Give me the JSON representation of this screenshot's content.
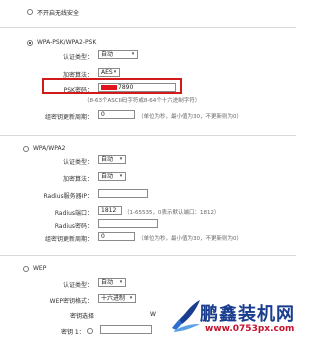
{
  "no_security": {
    "label": "不开启无线安全"
  },
  "wpa_psk": {
    "title": "WPA-PSK/WPA2-PSK",
    "auth_label": "认证类型：",
    "auth_value": "自动",
    "enc_label": "加密算法：",
    "enc_value": "AES",
    "psk_label": "PSK密码：",
    "psk_value": "7890",
    "psk_hint": "（8-63个ASCII码字符或8-64个十六进制字符）",
    "period_label": "组密钥更新周期：",
    "period_value": "0",
    "period_hint": "（单位为秒，最小值为30，不更新则为0）"
  },
  "wpa": {
    "title": "WPA/WPA2",
    "auth_label": "认证类型：",
    "auth_value": "自动",
    "enc_label": "加密算法：",
    "enc_value": "自动",
    "radius_ip_label": "Radius服务器IP：",
    "radius_ip_value": "",
    "radius_port_label": "Radius端口：",
    "radius_port_value": "1812",
    "radius_port_hint": "（1-65535，0表示默认端口：1812）",
    "radius_pwd_label": "Radius密码：",
    "radius_pwd_value": "",
    "period_label": "组密钥更新周期：",
    "period_value": "0",
    "period_hint": "（单位为秒，最小值为30，不更新则为0）"
  },
  "wep": {
    "title": "WEP",
    "auth_label": "认证类型：",
    "auth_value": "自动",
    "fmt_label": "WEP密钥格式：",
    "fmt_value": "十六进制",
    "key_select_label": "密钥选择",
    "key1_label": "密钥 1：",
    "key_col_header": "W"
  },
  "watermark": {
    "brand": "鹏鑫装机网",
    "url": "www.0753px.com"
  },
  "colors": {
    "highlight": "#d11a1a",
    "logo_blue": "#1a3d8f",
    "logo_red": "#c4122c"
  }
}
